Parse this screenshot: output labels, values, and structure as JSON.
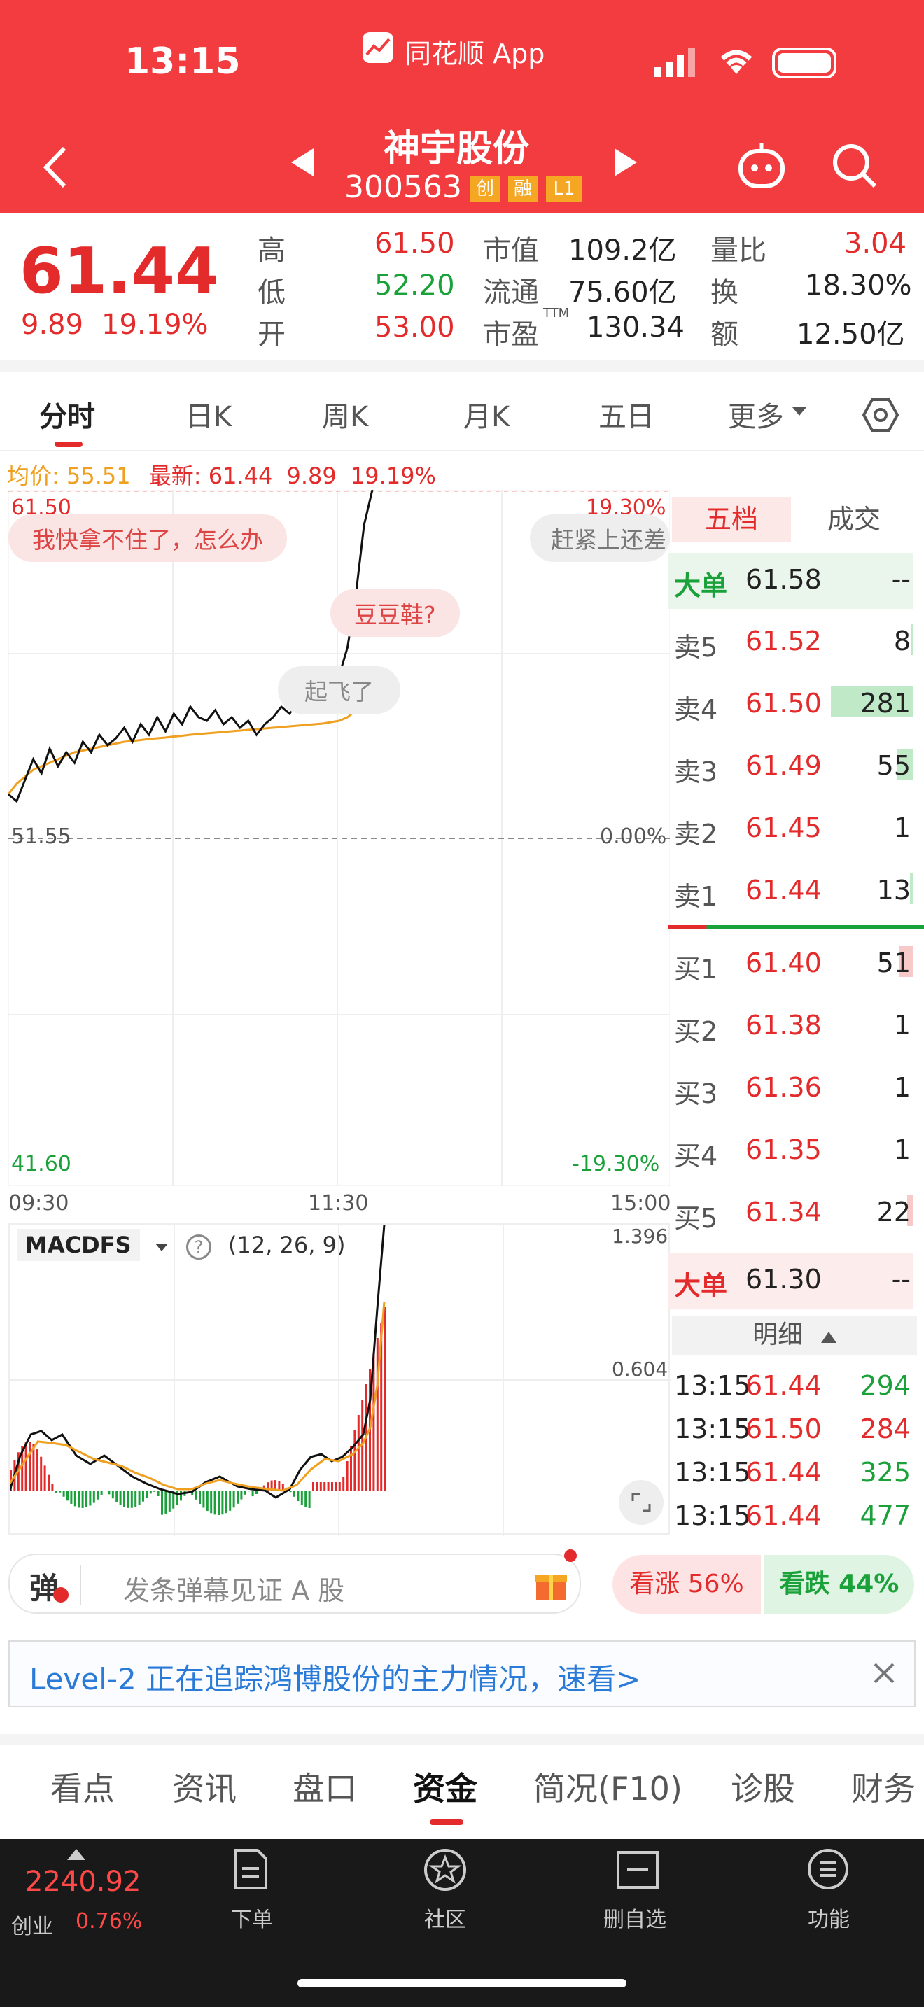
{
  "status": {
    "time": "13:15",
    "app": "同花顺 App"
  },
  "nav": {
    "name": "神宇股份",
    "code": "300563",
    "badges": [
      "创",
      "融",
      "L1"
    ]
  },
  "quote": {
    "price": "61.44",
    "change": "9.89",
    "pct": "19.19%",
    "cols": [
      {
        "label": "高",
        "value": "61.50"
      },
      {
        "label": "低",
        "value": "52.20"
      },
      {
        "label": "开",
        "value": "53.00"
      }
    ],
    "mid": [
      {
        "label": "市值",
        "value": "109.2亿"
      },
      {
        "label": "流通",
        "value": "75.60亿"
      },
      {
        "label": "市盈",
        "sup": "TTM",
        "value": "130.34"
      }
    ],
    "right": [
      {
        "label": "量比",
        "value": "3.04"
      },
      {
        "label": "换",
        "value": "18.30%"
      },
      {
        "label": "额",
        "value": "12.50亿"
      }
    ]
  },
  "tabs": [
    "分时",
    "日K",
    "周K",
    "月K",
    "五日",
    "更多"
  ],
  "info": {
    "avg_label": "均价:",
    "avg": "55.51",
    "last_label": "最新:",
    "last": "61.44",
    "chg": "9.89",
    "pct": "19.19%"
  },
  "chart": {
    "ymax": "61.50",
    "ymid": "51.55",
    "ymin": "41.60",
    "pmax": "19.30%",
    "pmid": "0.00%",
    "pmin": "-19.30%",
    "t0": "09:30",
    "t1": "11:30",
    "t2": "15:00",
    "danmaku": [
      "我快拿不住了，怎么办",
      "赶紧上还差",
      "豆豆鞋?",
      "起飞了"
    ],
    "price_series": [
      52.8,
      52.6,
      53.2,
      53.8,
      53.4,
      54.1,
      53.6,
      54.0,
      53.7,
      54.3,
      54.0,
      54.5,
      54.2,
      54.4,
      54.7,
      54.3,
      54.8,
      54.5,
      55.0,
      54.6,
      55.1,
      54.8,
      55.3,
      55.0,
      54.9,
      55.2,
      54.8,
      55.0,
      54.7,
      54.9,
      54.5,
      54.8,
      55.0,
      55.3,
      55.1,
      55.5,
      55.2,
      55.6,
      55.4,
      55.8,
      56.2,
      57.0,
      58.5,
      60.5,
      61.5
    ],
    "avg_series": [
      52.8,
      53.1,
      53.3,
      53.5,
      53.6,
      53.7,
      53.8,
      53.9,
      54.0,
      54.05,
      54.1,
      54.15,
      54.2,
      54.25,
      54.3,
      54.32,
      54.35,
      54.38,
      54.4,
      54.42,
      54.45,
      54.47,
      54.5,
      54.52,
      54.54,
      54.56,
      54.58,
      54.6,
      54.62,
      54.64,
      54.66,
      54.68,
      54.7,
      54.72,
      54.74,
      54.76,
      54.78,
      54.8,
      54.82,
      54.86,
      54.9,
      55.0,
      55.2,
      55.4,
      55.51
    ]
  },
  "macd": {
    "name": "MACDFS",
    "params": "(12, 26, 9)",
    "v1": "1.396",
    "v2": "0.604"
  },
  "book": {
    "tab1": "五档",
    "tab2": "成交",
    "big_sell": {
      "label": "大单",
      "price": "61.58",
      "vol": "--"
    },
    "asks": [
      {
        "label": "卖5",
        "price": "61.52",
        "vol": "8"
      },
      {
        "label": "卖4",
        "price": "61.50",
        "vol": "281"
      },
      {
        "label": "卖3",
        "price": "61.49",
        "vol": "55"
      },
      {
        "label": "卖2",
        "price": "61.45",
        "vol": "1"
      },
      {
        "label": "卖1",
        "price": "61.44",
        "vol": "13"
      }
    ],
    "bids": [
      {
        "label": "买1",
        "price": "61.40",
        "vol": "51"
      },
      {
        "label": "买2",
        "price": "61.38",
        "vol": "1"
      },
      {
        "label": "买3",
        "price": "61.36",
        "vol": "1"
      },
      {
        "label": "买4",
        "price": "61.35",
        "vol": "1"
      },
      {
        "label": "买5",
        "price": "61.34",
        "vol": "22"
      }
    ],
    "big_buy": {
      "label": "大单",
      "price": "61.30",
      "vol": "--"
    },
    "detail_label": "明细",
    "trades": [
      {
        "t": "13:15",
        "p": "61.44",
        "v": "294"
      },
      {
        "t": "13:15",
        "p": "61.50",
        "v": "284"
      },
      {
        "t": "13:15",
        "p": "61.44",
        "v": "325"
      },
      {
        "t": "13:15",
        "p": "61.44",
        "v": "477"
      }
    ]
  },
  "danmu": {
    "icon_label": "弹",
    "placeholder": "发条弹幕见证 A 股",
    "up": "看涨 56%",
    "down": "看跌 44%"
  },
  "banner": {
    "text": "Level-2 正在追踪鸿博股份的主力情况，速看>"
  },
  "bottom_tabs": [
    "看点",
    "资讯",
    "盘口",
    "资金",
    "简况(F10)",
    "诊股",
    "财务"
  ],
  "dock": {
    "index_value": "2240.92",
    "index_name": "创业",
    "index_pct": "0.76%",
    "items": [
      "下单",
      "社区",
      "删自选",
      "功能"
    ]
  }
}
